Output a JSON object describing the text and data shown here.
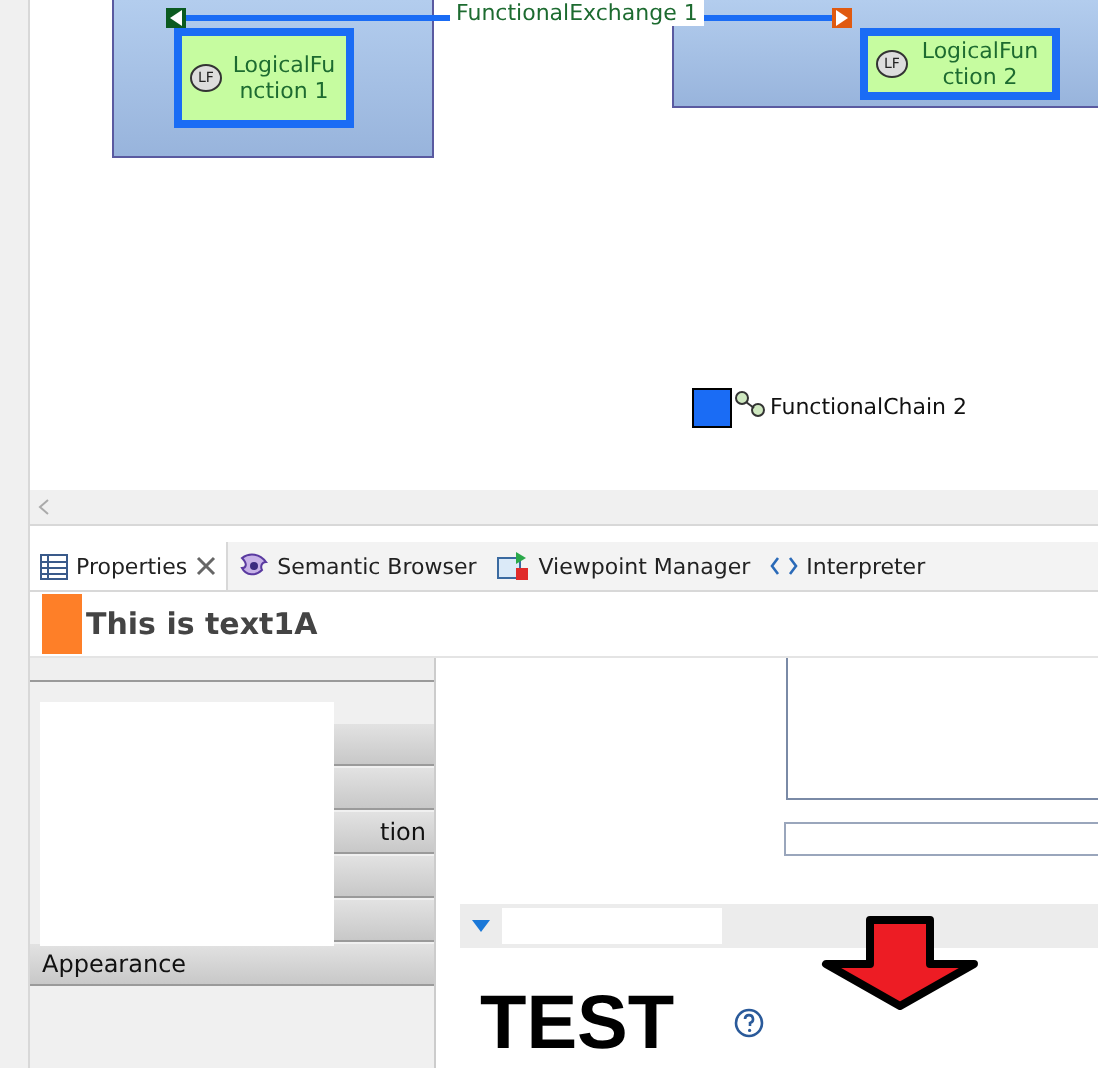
{
  "diagram": {
    "edge_label": "FunctionalExchange 1",
    "functions": [
      {
        "label": "LogicalFunction 1",
        "badge": "LF"
      },
      {
        "label": "LogicalFunction 2",
        "badge": "LF"
      }
    ],
    "chain": {
      "label": "FunctionalChain 2"
    }
  },
  "tabs": [
    {
      "label": "Properties",
      "selected": true,
      "closable": true,
      "kind": "properties"
    },
    {
      "label": "Semantic Browser",
      "selected": false,
      "closable": false,
      "kind": "browser"
    },
    {
      "label": "Viewpoint Manager",
      "selected": false,
      "closable": false,
      "kind": "viewpoint"
    },
    {
      "label": "Interpreter",
      "selected": false,
      "closable": false,
      "kind": "interpreter"
    }
  ],
  "header": {
    "title": "This is text1A"
  },
  "property_tabs": [
    {
      "selected": false
    },
    {
      "selected": false
    },
    {
      "selected": false
    },
    {
      "label": "tion",
      "selected": false
    },
    {
      "selected": false
    },
    {
      "selected": false
    },
    {
      "label": "Appearance",
      "selected": false
    }
  ],
  "section": {
    "expanded": true
  },
  "test": {
    "title": "TEST"
  }
}
